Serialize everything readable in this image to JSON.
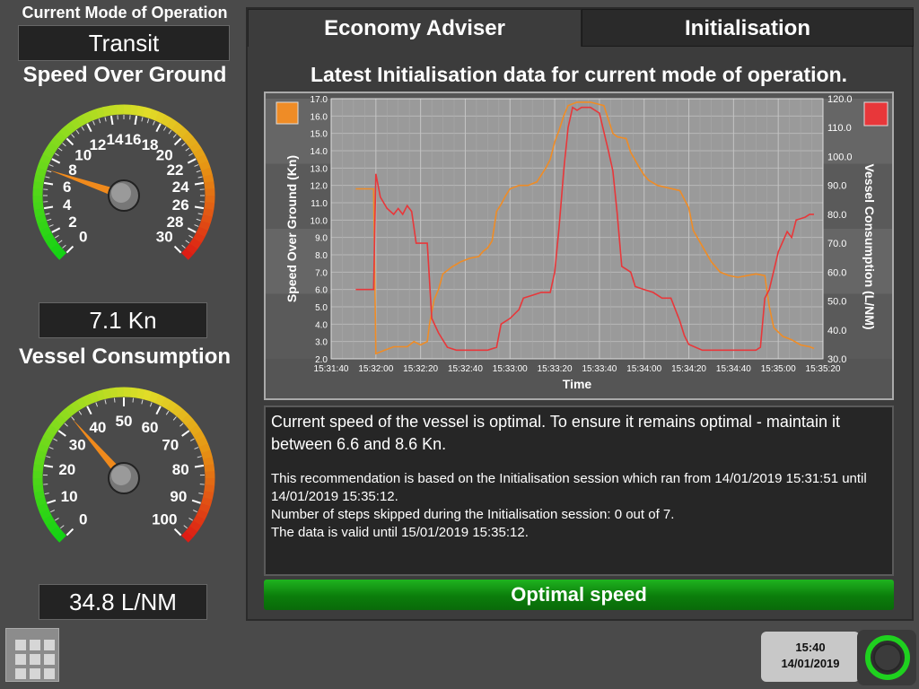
{
  "mode": {
    "label": "Current Mode of Operation",
    "value": "Transit"
  },
  "sog_gauge": {
    "title": "Speed Over Ground",
    "ticks": [
      "0",
      "2",
      "4",
      "6",
      "8",
      "10",
      "12",
      "14",
      "16",
      "18",
      "20",
      "22",
      "24",
      "26",
      "28",
      "30"
    ],
    "min": 0,
    "max": 30,
    "value": 7.1,
    "readout": "7.1 Kn"
  },
  "cons_gauge": {
    "title": "Vessel Consumption",
    "ticks": [
      "0",
      "10",
      "20",
      "30",
      "40",
      "50",
      "60",
      "70",
      "80",
      "90",
      "100"
    ],
    "min": 0,
    "max": 100,
    "value": 34.8,
    "readout": "34.8 L/NM"
  },
  "tabs": {
    "active": "Economy Adviser",
    "inactive": "Initialisation"
  },
  "heading": "Latest Initialisation data for current mode of operation.",
  "chart_data": {
    "type": "line",
    "xlabel": "Time",
    "ylabel": "Speed Over Ground (Kn)",
    "y2label": "Vessel Consumption (L/NM)",
    "x_ticks": [
      "15:31:40",
      "15:32:00",
      "15:32:20",
      "15:32:40",
      "15:33:00",
      "15:33:20",
      "15:33:40",
      "15:34:00",
      "15:34:20",
      "15:34:40",
      "15:35:00",
      "15:35:20"
    ],
    "y_ticks": [
      "2.0",
      "3.0",
      "4.0",
      "5.0",
      "6.0",
      "7.0",
      "8.0",
      "9.0",
      "10.0",
      "11.0",
      "12.0",
      "13.0",
      "14.0",
      "15.0",
      "16.0",
      "17.0"
    ],
    "y2_ticks": [
      "30.0",
      "40.0",
      "50.0",
      "60.0",
      "70.0",
      "80.0",
      "90.0",
      "100.0",
      "110.0",
      "120.0"
    ],
    "ylim": [
      2,
      17
    ],
    "y2lim": [
      30,
      120
    ],
    "xlim_seconds": [
      0,
      220
    ],
    "grid": true,
    "series": [
      {
        "name": "Speed Over Ground (Kn)",
        "axis": "left",
        "color": "#ef8c26",
        "points": [
          [
            11,
            11.8
          ],
          [
            19,
            11.8
          ],
          [
            20,
            2.3
          ],
          [
            24,
            2.5
          ],
          [
            28,
            2.7
          ],
          [
            34,
            2.7
          ],
          [
            37,
            3.0
          ],
          [
            40,
            2.8
          ],
          [
            43,
            3.0
          ],
          [
            44,
            4.0
          ],
          [
            46,
            5.4
          ],
          [
            48,
            6.0
          ],
          [
            50,
            6.9
          ],
          [
            54,
            7.3
          ],
          [
            58,
            7.6
          ],
          [
            62,
            7.8
          ],
          [
            66,
            7.9
          ],
          [
            68,
            8.2
          ],
          [
            70,
            8.4
          ],
          [
            72,
            8.8
          ],
          [
            74,
            10.5
          ],
          [
            76,
            10.9
          ],
          [
            78,
            11.4
          ],
          [
            80,
            11.8
          ],
          [
            84,
            12.0
          ],
          [
            88,
            12.0
          ],
          [
            92,
            12.2
          ],
          [
            96,
            13.0
          ],
          [
            98,
            13.5
          ],
          [
            100,
            14.5
          ],
          [
            102,
            15.2
          ],
          [
            104,
            16.0
          ],
          [
            106,
            16.6
          ],
          [
            110,
            16.8
          ],
          [
            116,
            16.8
          ],
          [
            122,
            16.6
          ],
          [
            126,
            15.0
          ],
          [
            128,
            14.8
          ],
          [
            132,
            14.7
          ],
          [
            134,
            13.9
          ],
          [
            138,
            13.0
          ],
          [
            140,
            12.6
          ],
          [
            142,
            12.3
          ],
          [
            146,
            12.0
          ],
          [
            156,
            11.7
          ],
          [
            160,
            10.7
          ],
          [
            162,
            9.4
          ],
          [
            166,
            8.5
          ],
          [
            170,
            7.6
          ],
          [
            174,
            7.0
          ],
          [
            178,
            6.8
          ],
          [
            182,
            6.7
          ],
          [
            186,
            6.8
          ],
          [
            190,
            6.9
          ],
          [
            194,
            6.8
          ],
          [
            196,
            5.0
          ],
          [
            198,
            3.8
          ],
          [
            202,
            3.3
          ],
          [
            206,
            3.1
          ],
          [
            210,
            2.8
          ],
          [
            214,
            2.7
          ],
          [
            216,
            2.6
          ]
        ]
      },
      {
        "name": "Vessel Consumption (L/NM)",
        "axis": "right",
        "color": "#e8373a",
        "points": [
          [
            11,
            54
          ],
          [
            19,
            54
          ],
          [
            20,
            94
          ],
          [
            22,
            86
          ],
          [
            25,
            82
          ],
          [
            28,
            80
          ],
          [
            30,
            82
          ],
          [
            32,
            80
          ],
          [
            34,
            83
          ],
          [
            36,
            81
          ],
          [
            38,
            70
          ],
          [
            40,
            70
          ],
          [
            43,
            70
          ],
          [
            45,
            44
          ],
          [
            48,
            39
          ],
          [
            52,
            34
          ],
          [
            56,
            33
          ],
          [
            62,
            33
          ],
          [
            66,
            33
          ],
          [
            70,
            33
          ],
          [
            74,
            34
          ],
          [
            76,
            42
          ],
          [
            80,
            44
          ],
          [
            84,
            47
          ],
          [
            86,
            51
          ],
          [
            90,
            52
          ],
          [
            94,
            53
          ],
          [
            98,
            53
          ],
          [
            100,
            60
          ],
          [
            102,
            76
          ],
          [
            104,
            95
          ],
          [
            106,
            110
          ],
          [
            108,
            117
          ],
          [
            110,
            116
          ],
          [
            112,
            117
          ],
          [
            116,
            117
          ],
          [
            120,
            115
          ],
          [
            124,
            102
          ],
          [
            126,
            95
          ],
          [
            128,
            80
          ],
          [
            130,
            62
          ],
          [
            134,
            60
          ],
          [
            136,
            55
          ],
          [
            140,
            54
          ],
          [
            144,
            53
          ],
          [
            148,
            51
          ],
          [
            152,
            51
          ],
          [
            154,
            47
          ],
          [
            156,
            43
          ],
          [
            158,
            38
          ],
          [
            160,
            35
          ],
          [
            166,
            33
          ],
          [
            170,
            33
          ],
          [
            174,
            33
          ],
          [
            180,
            33
          ],
          [
            186,
            33
          ],
          [
            190,
            33
          ],
          [
            192,
            34
          ],
          [
            194,
            51
          ],
          [
            196,
            54
          ],
          [
            200,
            67
          ],
          [
            204,
            74
          ],
          [
            206,
            72
          ],
          [
            208,
            78
          ],
          [
            212,
            79
          ],
          [
            214,
            80
          ],
          [
            216,
            80
          ]
        ]
      }
    ]
  },
  "message": {
    "main": "Current speed of the vessel is optimal. To ensure it remains optimal - maintain it between 6.6 and 8.6 Kn.",
    "line1": "This recommendation is based on the Initialisation session which ran from 14/01/2019 15:31:51 until 14/01/2019 15:35:12.",
    "line2": "Number of steps skipped during the Initialisation session: 0 out of 7.",
    "line3": "The data is valid until 15/01/2019 15:35:12."
  },
  "status": {
    "label": "Optimal speed",
    "color": "#17a317"
  },
  "clock": {
    "time": "15:40",
    "date": "14/01/2019"
  },
  "icons": {
    "menu": "grid-menu-icon",
    "ring": "status-ring-icon",
    "series_sog": "orange-square-legend-icon",
    "series_cons": "red-square-legend-icon"
  }
}
